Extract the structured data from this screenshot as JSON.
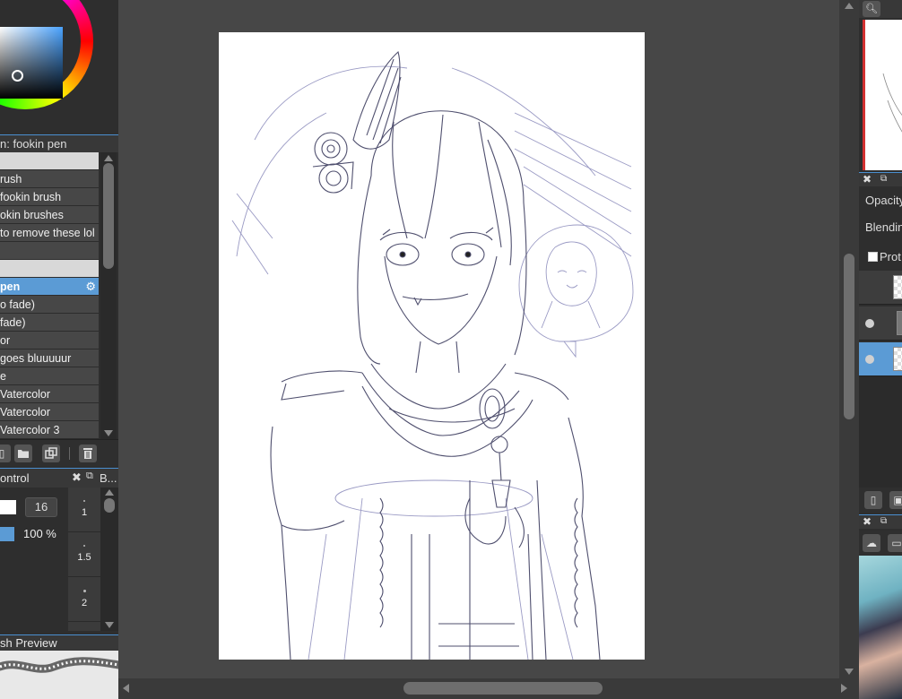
{
  "left_panel": {
    "brush_set_title": "n: fookin pen",
    "brushes": [
      {
        "label": "",
        "type": "group"
      },
      {
        "label": "rush",
        "type": "item"
      },
      {
        "label": " fookin brush",
        "type": "item"
      },
      {
        "label": "okin brushes",
        "type": "item"
      },
      {
        "label": "to remove these lol",
        "type": "item"
      },
      {
        "label": "",
        "type": "item"
      },
      {
        "label": "",
        "type": "group"
      },
      {
        "label": "pen",
        "type": "selected"
      },
      {
        "label": "o fade)",
        "type": "item"
      },
      {
        "label": "fade)",
        "type": "item"
      },
      {
        "label": "or",
        "type": "item"
      },
      {
        "label": " goes bluuuuur",
        "type": "item"
      },
      {
        "label": "e",
        "type": "item"
      },
      {
        "label": "Vatercolor",
        "type": "item"
      },
      {
        "label": "Vatercolor",
        "type": "item"
      },
      {
        "label": "Vatercolor 3",
        "type": "item"
      }
    ],
    "control_title": "ontrol",
    "brush_size_value": "16",
    "opacity_value": "100 %",
    "brush_size_panel_title": "B...",
    "brush_sizes": [
      "1",
      "1.5",
      "2"
    ],
    "preview_title": "sh Preview"
  },
  "right_panel": {
    "opacity_label": "Opacity",
    "blending_label": "Blendin",
    "protect_label": "Prot"
  },
  "colors": {
    "accent": "#5b9bd5",
    "canvas_bg": "#474747",
    "panel_bg": "#2e2e2e",
    "sketch_line": "#6b6b8a"
  }
}
